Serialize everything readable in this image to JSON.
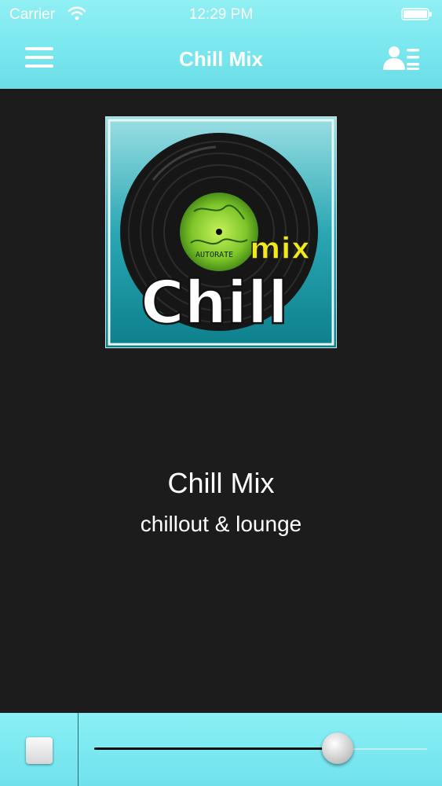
{
  "status_bar": {
    "carrier": "Carrier",
    "time": "12:29 PM",
    "icons": [
      "wifi-icon",
      "battery-icon"
    ]
  },
  "nav": {
    "title": "Chill Mix",
    "left_icon": "menu-icon",
    "right_icon": "contacts-list-icon"
  },
  "artwork": {
    "word_top": "mix",
    "word_main": "Chill",
    "label_text": "AUTORATE"
  },
  "station": {
    "name": "Chill Mix",
    "genre": "chillout & lounge"
  },
  "player": {
    "stop_icon": "stop-icon",
    "volume_fraction": 0.73
  },
  "colors": {
    "header": "#78e6ee",
    "background": "#1c1c1c",
    "text": "#ffffff"
  }
}
